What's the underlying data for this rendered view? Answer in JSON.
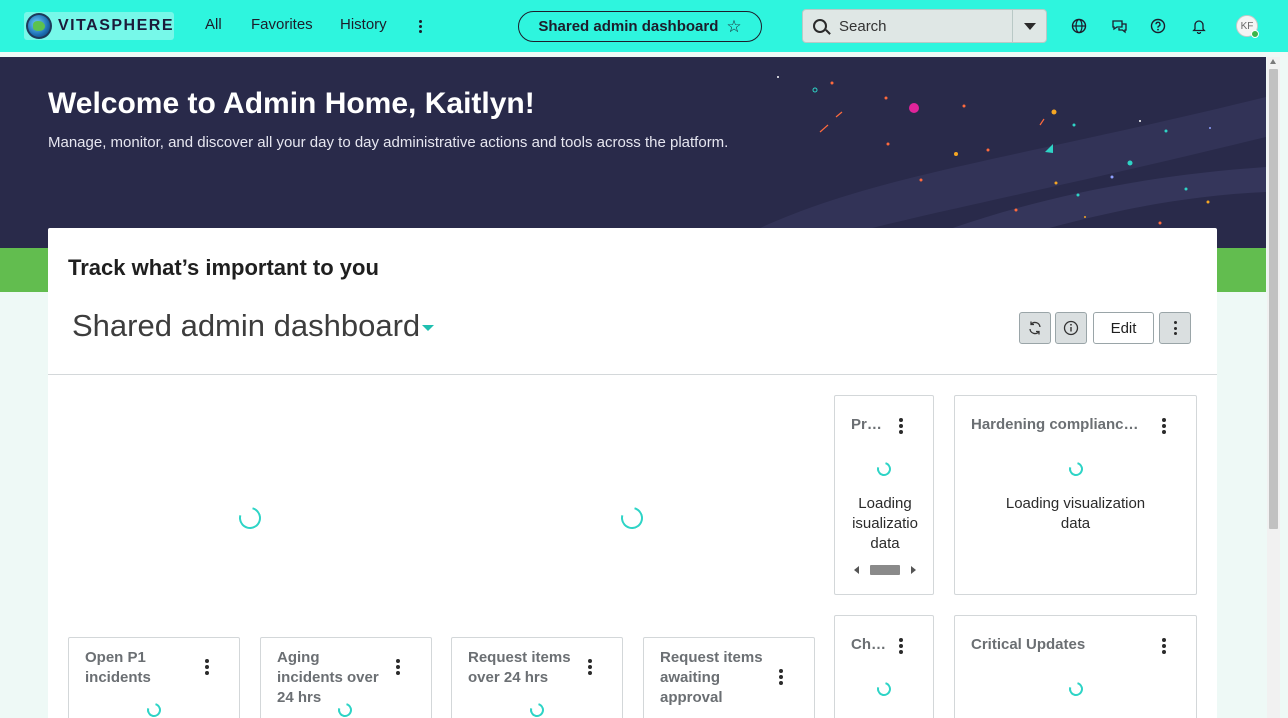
{
  "brand": {
    "name": "VITASPHERE"
  },
  "nav": {
    "all": "All",
    "favorites": "Favorites",
    "history": "History"
  },
  "pill": {
    "label": "Shared admin dashboard",
    "icon": "star-outline-icon"
  },
  "search": {
    "placeholder": "Search"
  },
  "user": {
    "initials": "KF"
  },
  "hero": {
    "title": "Welcome to Admin Home, Kaitlyn!",
    "subtitle": "Manage, monitor, and discover all your day to day administrative actions and tools across the platform."
  },
  "card": {
    "heading": "Track what’s important to you",
    "dashboard_title": "Shared admin dashboard",
    "edit_label": "Edit"
  },
  "widgets": {
    "w1": {
      "title": "Pr…",
      "loading": "Loading isualizatio data"
    },
    "w2": {
      "title": "Hardening compliance …",
      "loading": "Loading visualization data"
    },
    "w3": {
      "title": "Ch…"
    },
    "w4": {
      "title": "Critical Updates"
    }
  },
  "tiles": [
    {
      "title": "Open P1 incidents"
    },
    {
      "title": "Aging incidents over 24 hrs"
    },
    {
      "title": "Request items over 24 hrs"
    },
    {
      "title": "Request items awaiting approval"
    }
  ],
  "colors": {
    "nav_bg": "#2ef5de",
    "hero_bg": "#292a4a",
    "accent": "#2ed4c6",
    "band": "#62bd4f"
  }
}
